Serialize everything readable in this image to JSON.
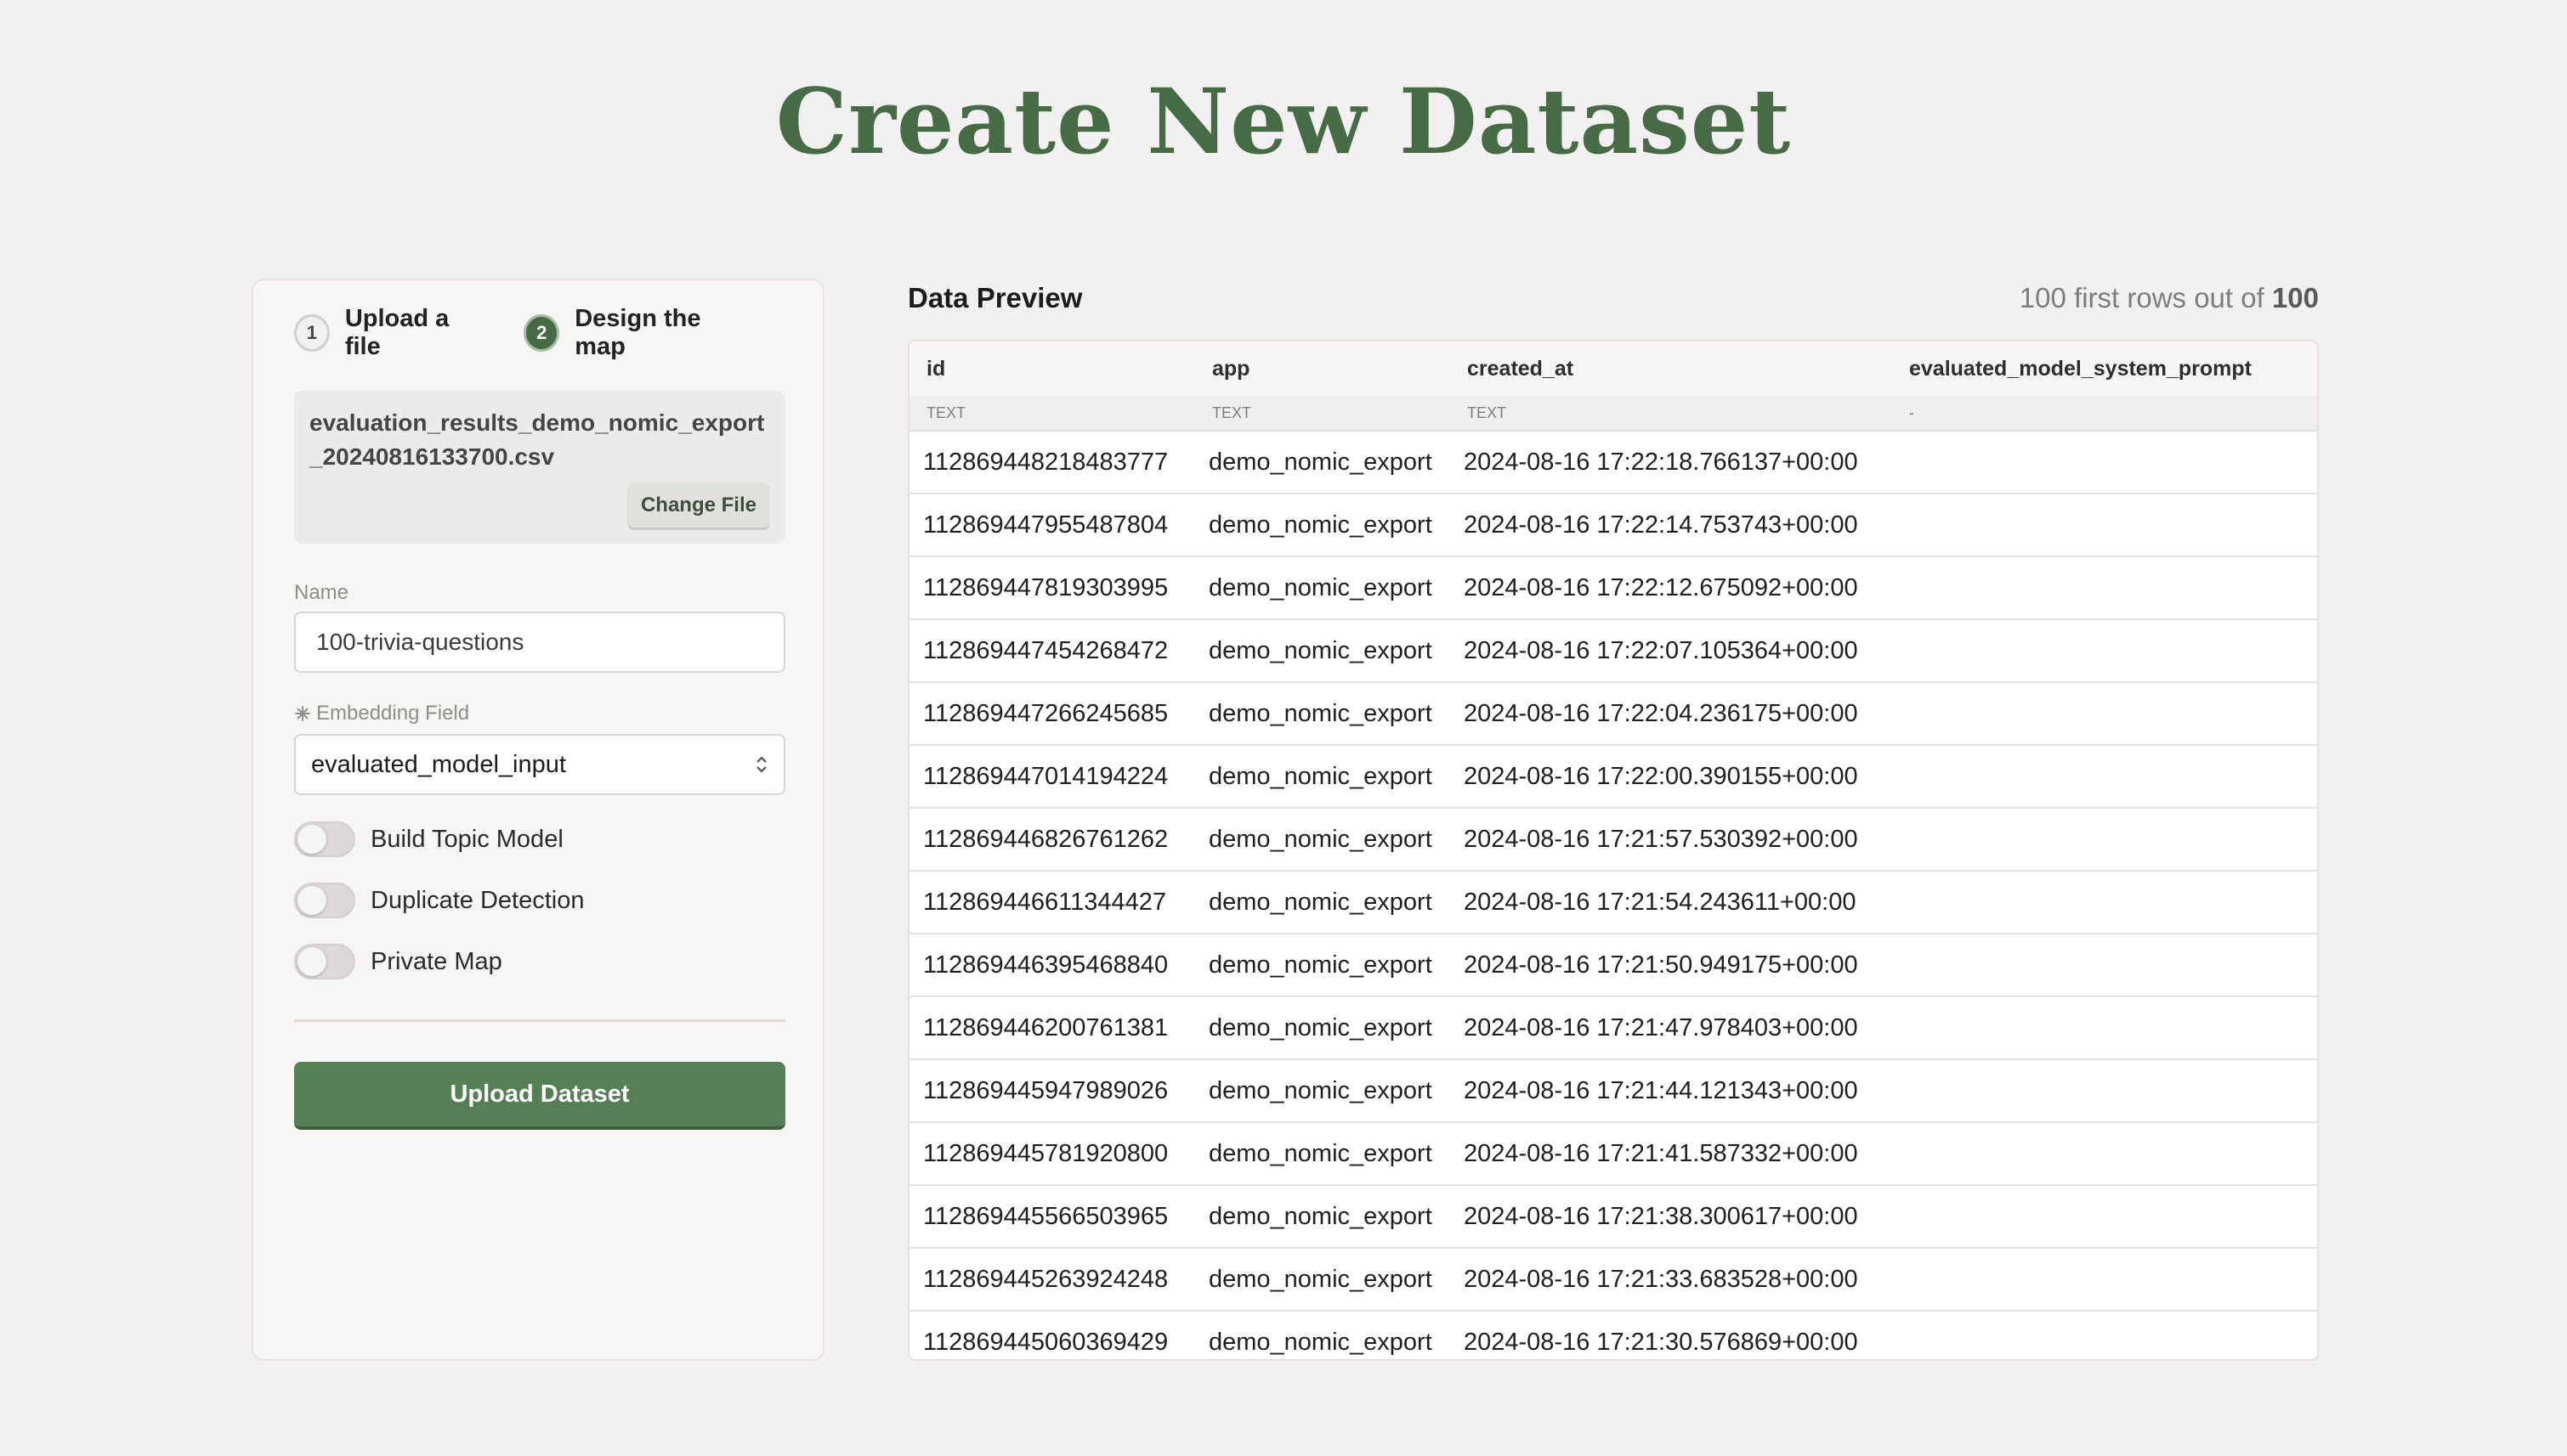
{
  "page": {
    "title": "Create New Dataset"
  },
  "steps": [
    {
      "number": "1",
      "label": "Upload a file"
    },
    {
      "number": "2",
      "label": "Design the map"
    }
  ],
  "file": {
    "name": "evaluation_results_demo_nomic_export_20240816133700.csv",
    "change_label": "Change File"
  },
  "form": {
    "name_label": "Name",
    "name_value": "100-trivia-questions",
    "embedding_label": "Embedding Field",
    "embedding_value": "evaluated_model_input",
    "toggles": [
      {
        "label": "Build Topic Model",
        "on": false
      },
      {
        "label": "Duplicate Detection",
        "on": false
      },
      {
        "label": "Private Map",
        "on": false
      }
    ],
    "upload_label": "Upload Dataset"
  },
  "preview": {
    "title": "Data Preview",
    "rows_text": "100 first rows out of ",
    "rows_total": "100",
    "columns": [
      {
        "name": "id",
        "type": "TEXT"
      },
      {
        "name": "app",
        "type": "TEXT"
      },
      {
        "name": "created_at",
        "type": "TEXT"
      },
      {
        "name": "evaluated_model_system_prompt",
        "type": "-"
      }
    ],
    "rows": [
      [
        "112869448218483777",
        "demo_nomic_export",
        "2024-08-16 17:22:18.766137+00:00",
        ""
      ],
      [
        "112869447955487804",
        "demo_nomic_export",
        "2024-08-16 17:22:14.753743+00:00",
        ""
      ],
      [
        "112869447819303995",
        "demo_nomic_export",
        "2024-08-16 17:22:12.675092+00:00",
        ""
      ],
      [
        "112869447454268472",
        "demo_nomic_export",
        "2024-08-16 17:22:07.105364+00:00",
        ""
      ],
      [
        "112869447266245685",
        "demo_nomic_export",
        "2024-08-16 17:22:04.236175+00:00",
        ""
      ],
      [
        "112869447014194224",
        "demo_nomic_export",
        "2024-08-16 17:22:00.390155+00:00",
        ""
      ],
      [
        "112869446826761262",
        "demo_nomic_export",
        "2024-08-16 17:21:57.530392+00:00",
        ""
      ],
      [
        "112869446611344427",
        "demo_nomic_export",
        "2024-08-16 17:21:54.243611+00:00",
        ""
      ],
      [
        "112869446395468840",
        "demo_nomic_export",
        "2024-08-16 17:21:50.949175+00:00",
        ""
      ],
      [
        "112869446200761381",
        "demo_nomic_export",
        "2024-08-16 17:21:47.978403+00:00",
        ""
      ],
      [
        "112869445947989026",
        "demo_nomic_export",
        "2024-08-16 17:21:44.121343+00:00",
        ""
      ],
      [
        "112869445781920800",
        "demo_nomic_export",
        "2024-08-16 17:21:41.587332+00:00",
        ""
      ],
      [
        "112869445566503965",
        "demo_nomic_export",
        "2024-08-16 17:21:38.300617+00:00",
        ""
      ],
      [
        "112869445263924248",
        "demo_nomic_export",
        "2024-08-16 17:21:33.683528+00:00",
        ""
      ],
      [
        "112869445060369429",
        "demo_nomic_export",
        "2024-08-16 17:21:30.576869+00:00",
        ""
      ]
    ]
  },
  "icons": {
    "embedding": "sparkle-icon",
    "select": "chevron-up-down-icon"
  },
  "colors": {
    "accent": "#466b45",
    "button": "#577f56",
    "background": "#f2f0f0"
  }
}
